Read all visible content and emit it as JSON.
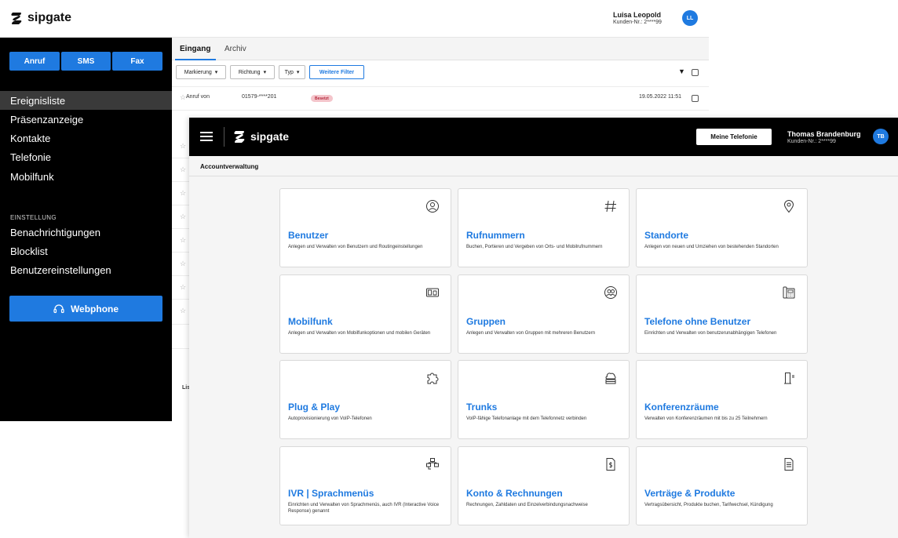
{
  "back_window": {
    "logo_text": "sipgate",
    "user": {
      "name": "Luisa Leopold",
      "customer_id": "Kunden-Nr.: 2****99",
      "initials": "LL"
    },
    "sidebar": {
      "buttons": {
        "call": "Anruf",
        "sms": "SMS",
        "fax": "Fax"
      },
      "items": [
        "Ereignisliste",
        "Präsenzanzeige",
        "Kontakte",
        "Telefonie",
        "Mobilfunk"
      ],
      "section_label": "EINSTELLUNG",
      "settings_items": [
        "Benachrichtigungen",
        "Blocklist",
        "Benutzereinstellungen"
      ],
      "webphone_label": "Webphone"
    },
    "tabs": {
      "inbox": "Eingang",
      "archive": "Archiv"
    },
    "filters": {
      "marking": "Markierung",
      "direction": "Richtung",
      "type": "Typ",
      "more": "Weitere Filter"
    },
    "row1": {
      "type": "Anruf von",
      "number": "01579-****201",
      "badge": "Besetzt",
      "date": "19.05.2022 11:51"
    },
    "truncated_text": "Lis"
  },
  "front_window": {
    "logo_text": "sipgate",
    "meine_telefonie": "Meine Telefonie",
    "user": {
      "name": "Thomas Brandenburg",
      "customer_id": "Kunden-Nr.: 2****99",
      "initials": "TB"
    },
    "page_title": "Accountverwaltung",
    "tiles": [
      {
        "title": "Benutzer",
        "desc": "Anlegen und Verwalten von Benutzern und Routingeinstellungen",
        "icon": "user-icon"
      },
      {
        "title": "Rufnummern",
        "desc": "Buchen, Portieren und Vergeben von Orts- und Mobilrufnummern",
        "icon": "hash-icon"
      },
      {
        "title": "Standorte",
        "desc": "Anlegen von neuen und Umziehen von bestehenden Standorten",
        "icon": "location-pin-icon"
      },
      {
        "title": "Mobilfunk",
        "desc": "Anlegen und Verwalten von Mobilfunkoptionen und mobilen Geräten",
        "icon": "sim-card-icon"
      },
      {
        "title": "Gruppen",
        "desc": "Anlegen und Verwalten von Gruppen mit mehreren Benutzern",
        "icon": "group-icon"
      },
      {
        "title": "Telefone ohne Benutzer",
        "desc": "Einrichten und Verwalten von benutzerunabhängigen Telefonen",
        "icon": "desk-phone-icon"
      },
      {
        "title": "Plug & Play",
        "desc": "Autoprovisionierung von VoIP-Telefonen",
        "icon": "puzzle-icon"
      },
      {
        "title": "Trunks",
        "desc": "VoIP-fähige Telefonanlage mit dem Telefonnetz verbinden",
        "icon": "cloud-server-icon"
      },
      {
        "title": "Konferenzräume",
        "desc": "Verwalten von Konferenzräumen mit bis zu 25 Teilnehmern",
        "icon": "door-icon"
      },
      {
        "title": "IVR | Sprachmenüs",
        "desc": "Einrichten und Verwalten von Sprachmenüs, auch IVR (Interactive Voice Response) genannt",
        "icon": "flow-chart-icon"
      },
      {
        "title": "Konto & Rechnungen",
        "desc": "Rechnungen, Zahldaten und Einzelverbindungsnachweise",
        "icon": "invoice-icon"
      },
      {
        "title": "Verträge & Produkte",
        "desc": "Vertragsübersicht, Produkte buchen, Tarifwechsel, Kündigung",
        "icon": "document-icon"
      }
    ]
  },
  "colors": {
    "brand_blue": "#1f7ae0",
    "sidebar_bg": "#000000",
    "badge_bg": "#f4c5cb",
    "badge_text": "#b3263a"
  }
}
